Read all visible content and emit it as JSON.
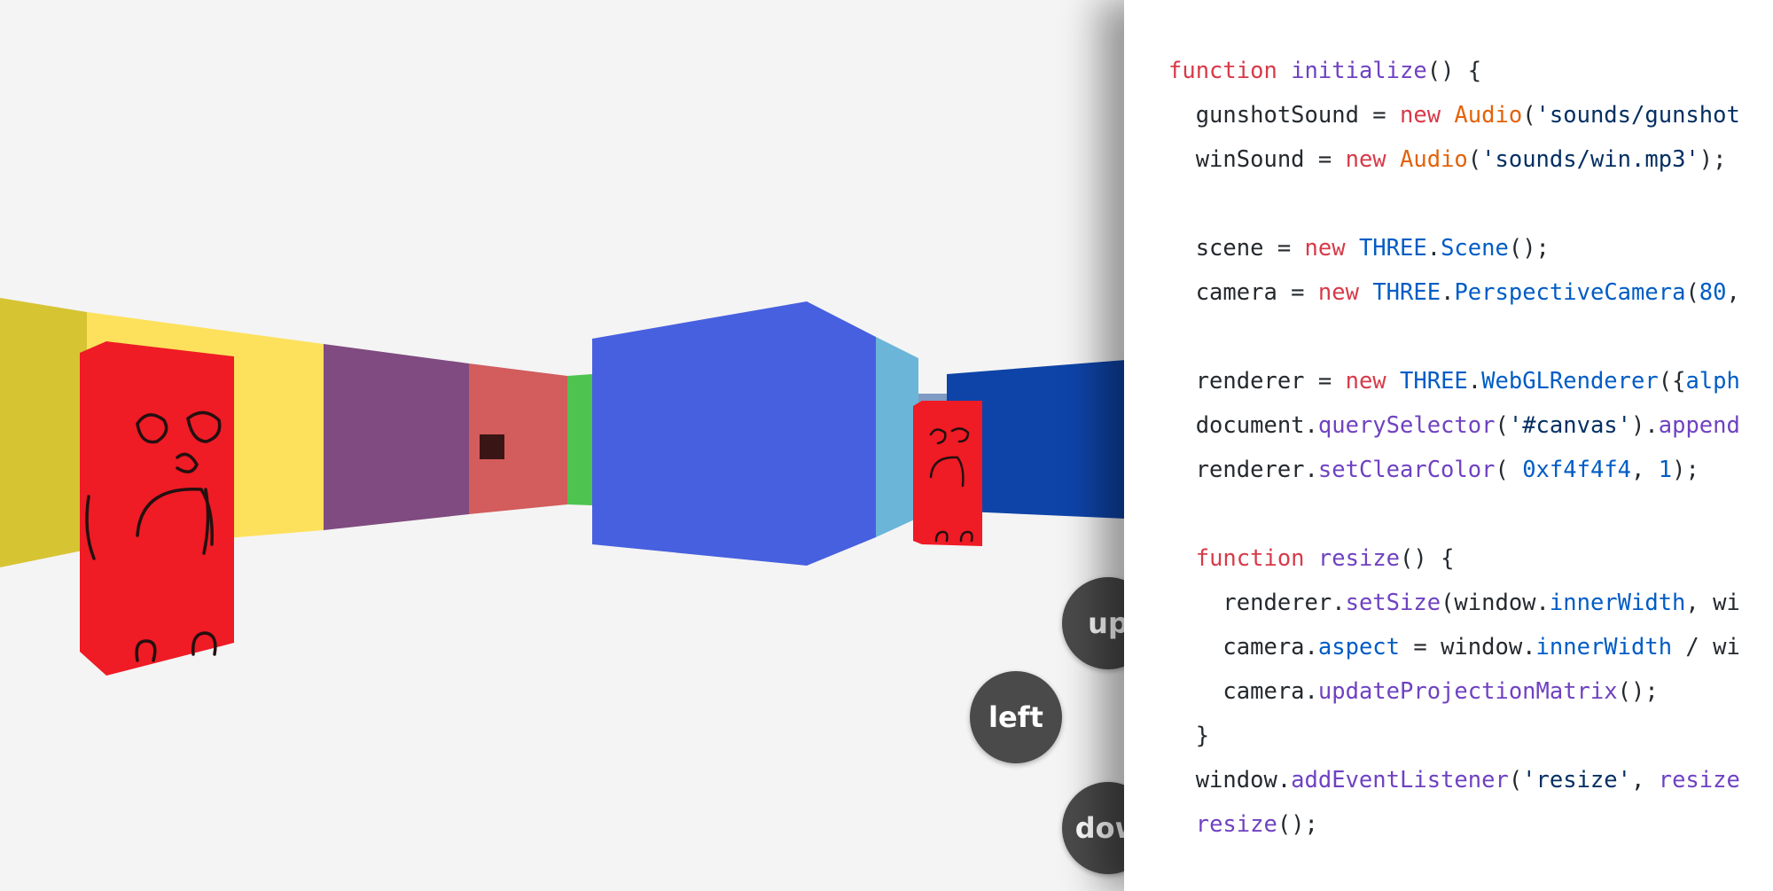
{
  "game": {
    "controls": {
      "up_label": "up",
      "left_label": "left",
      "down_label": "dow"
    },
    "colors": {
      "background": "#f4f4f4",
      "wall_olive": "#d6c433",
      "wall_yellow": "#fde15c",
      "wall_purple": "#7f4b80",
      "wall_salmon": "#d35c5c",
      "wall_green": "#4fc34f",
      "wall_royal_blue": "#4760df",
      "wall_light_blue": "#6bb5d8",
      "wall_dark_blue": "#0e44a8",
      "enemy_red": "#ef1b25",
      "button": "#4a4a4a"
    }
  },
  "code": {
    "lines": [
      "function initialize() {",
      "  gunshotSound = new Audio('sounds/gunshot",
      "  winSound = new Audio('sounds/win.mp3');",
      "",
      "  scene = new THREE.Scene();",
      "  camera = new THREE.PerspectiveCamera(80,",
      "",
      "  renderer = new THREE.WebGLRenderer({alph",
      "  document.querySelector('#canvas').append",
      "  renderer.setClearColor( 0xf4f4f4, 1);",
      "",
      "  function resize() {",
      "    renderer.setSize(window.innerWidth, wi",
      "    camera.aspect = window.innerWidth / wi",
      "    camera.updateProjectionMatrix();",
      "  }",
      "  window.addEventListener('resize', resize",
      "  resize();"
    ]
  }
}
